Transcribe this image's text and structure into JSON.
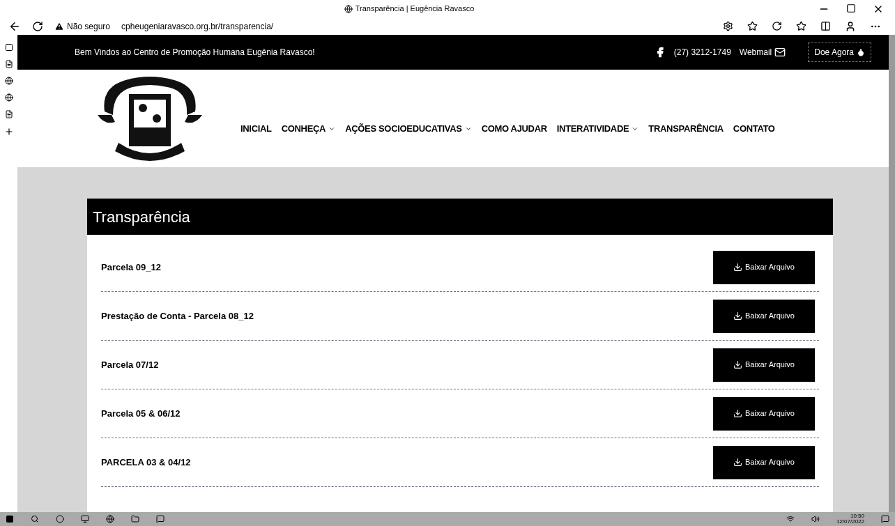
{
  "window": {
    "title": "Transparência | Eugência Ravasco"
  },
  "address_bar": {
    "security": "Não seguro",
    "url": "cpheugeniaravasco.org.br/transparencia/"
  },
  "top_bar": {
    "welcome": "Bem Vindos ao Centro de Promoção Humana Eugênia Ravasco!",
    "phone": "(27) 3212-1749",
    "webmail": "Webmail",
    "donate": "Doe Agora"
  },
  "nav": [
    {
      "label": "INICIAL",
      "dropdown": false
    },
    {
      "label": "CONHEÇA",
      "dropdown": true
    },
    {
      "label": "AÇÕES SOCIOEDUCATIVAS",
      "dropdown": true
    },
    {
      "label": "COMO AJUDAR",
      "dropdown": false
    },
    {
      "label": "INTERATIVIDADE",
      "dropdown": true
    },
    {
      "label": "TRANSPARÊNCIA",
      "dropdown": false
    },
    {
      "label": "CONTATO",
      "dropdown": false
    }
  ],
  "section": {
    "title": "Transparência"
  },
  "documents": [
    {
      "name": "Parcela 09_12",
      "button": "Baixar Arquivo"
    },
    {
      "name": "Prestação de Conta - Parcela 08_12",
      "button": "Baixar Arquivo"
    },
    {
      "name": "Parcela 07/12",
      "button": "Baixar Arquivo"
    },
    {
      "name": "Parcela 05 & 06/12",
      "button": "Baixar Arquivo"
    },
    {
      "name": "PARCELA 03 & 04/12",
      "button": "Baixar Arquivo"
    }
  ],
  "taskbar": {
    "time": "10:50",
    "date": "12/07/2022"
  }
}
